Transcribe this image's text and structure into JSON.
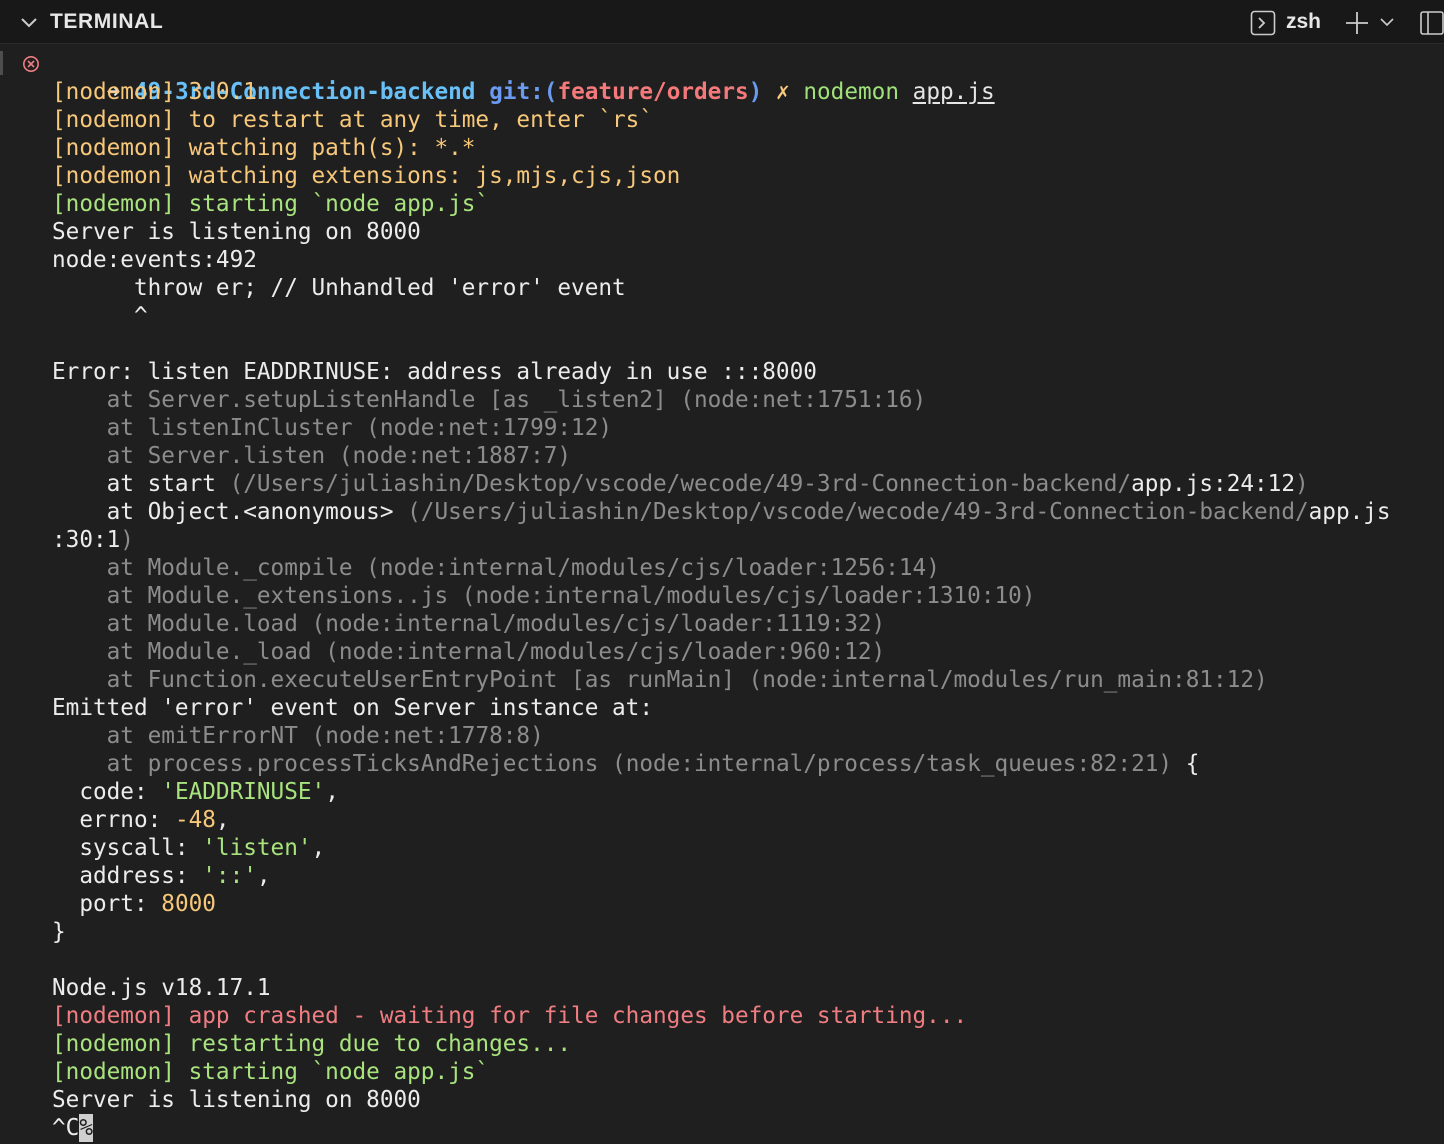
{
  "panel": {
    "title": "TERMINAL",
    "shell": "zsh"
  },
  "colors": {
    "background": "#1f1f1f",
    "header_bg": "#181818",
    "nodemon_info": "#f7c77a",
    "nodemon_start": "#a8e37e",
    "nodemon_error": "#f07d82",
    "stack_dim": "#8c8c8c",
    "prompt_dir": "#68c0f7",
    "prompt_branch": "#f5797b"
  },
  "prompt": {
    "arrow": "➜",
    "dir": "49-3rd-Connection-backend",
    "git_open": "git:(",
    "branch": "feature/orders",
    "git_close": ")",
    "dirty": "✗",
    "command": "nodemon",
    "argument": "app.js"
  },
  "output": {
    "l01": "[nodemon] 3.0.1",
    "l02": "[nodemon] to restart at any time, enter `rs`",
    "l03": "[nodemon] watching path(s): *.*",
    "l04": "[nodemon] watching extensions: js,mjs,cjs,json",
    "l05": "[nodemon] starting `node app.js`",
    "l06": "Server is listening on 8000",
    "l07": "node:events:492",
    "l08": "      throw er; // Unhandled 'error' event",
    "l09": "      ^",
    "l10": "Error: listen EADDRINUSE: address already in use :::8000",
    "l11_at": "    at ",
    "l11": "Server.setupListenHandle [as _listen2] (node:net:1751:16)",
    "l12_at": "    at ",
    "l12": "listenInCluster (node:net:1799:12)",
    "l13_at": "    at ",
    "l13": "Server.listen (node:net:1887:7)",
    "l14_at": "    at start ",
    "l14_path": "(/Users/juliashin/Desktop/vscode/wecode/49-3rd-Connection-backend/",
    "l14_file": "app.js:24:12",
    "l14_close": ")",
    "l15_at": "    at Object.<anonymous> ",
    "l15_path": "(/Users/juliashin/Desktop/vscode/wecode/49-3rd-Connection-backend/",
    "l15_file": "app.js",
    "l16_pos": ":30:1",
    "l16_close": ")",
    "l17_at": "    at ",
    "l17": "Module._compile (node:internal/modules/cjs/loader:1256:14)",
    "l18_at": "    at ",
    "l18": "Module._extensions..js (node:internal/modules/cjs/loader:1310:10)",
    "l19_at": "    at ",
    "l19": "Module.load (node:internal/modules/cjs/loader:1119:32)",
    "l20_at": "    at ",
    "l20": "Module._load (node:internal/modules/cjs/loader:960:12)",
    "l21_at": "    at ",
    "l21": "Function.executeUserEntryPoint [as runMain] (node:internal/modules/run_main:81:12)",
    "l22": "Emitted 'error' event on Server instance at:",
    "l23_at": "    at ",
    "l23": "emitErrorNT (node:net:1778:8)",
    "l24_at": "    at ",
    "l24": "process.processTicksAndRejections (node:internal/process/task_queues:82:21)",
    "l24_brace": " {",
    "l25_key": "  code: ",
    "l25_val": "'EADDRINUSE'",
    "l25_end": ",",
    "l26_key": "  errno: ",
    "l26_val": "-48",
    "l26_end": ",",
    "l27_key": "  syscall: ",
    "l27_val": "'listen'",
    "l27_end": ",",
    "l28_key": "  address: ",
    "l28_val": "'::'",
    "l28_end": ",",
    "l29_key": "  port: ",
    "l29_val": "8000",
    "l30": "}",
    "l31": "Node.js v18.17.1",
    "l32": "[nodemon] app crashed - waiting for file changes before starting...",
    "l33": "[nodemon] restarting due to changes...",
    "l34": "[nodemon] starting `node app.js`",
    "l35": "Server is listening on 8000",
    "l36": "^C",
    "l36_cursor": "%"
  }
}
